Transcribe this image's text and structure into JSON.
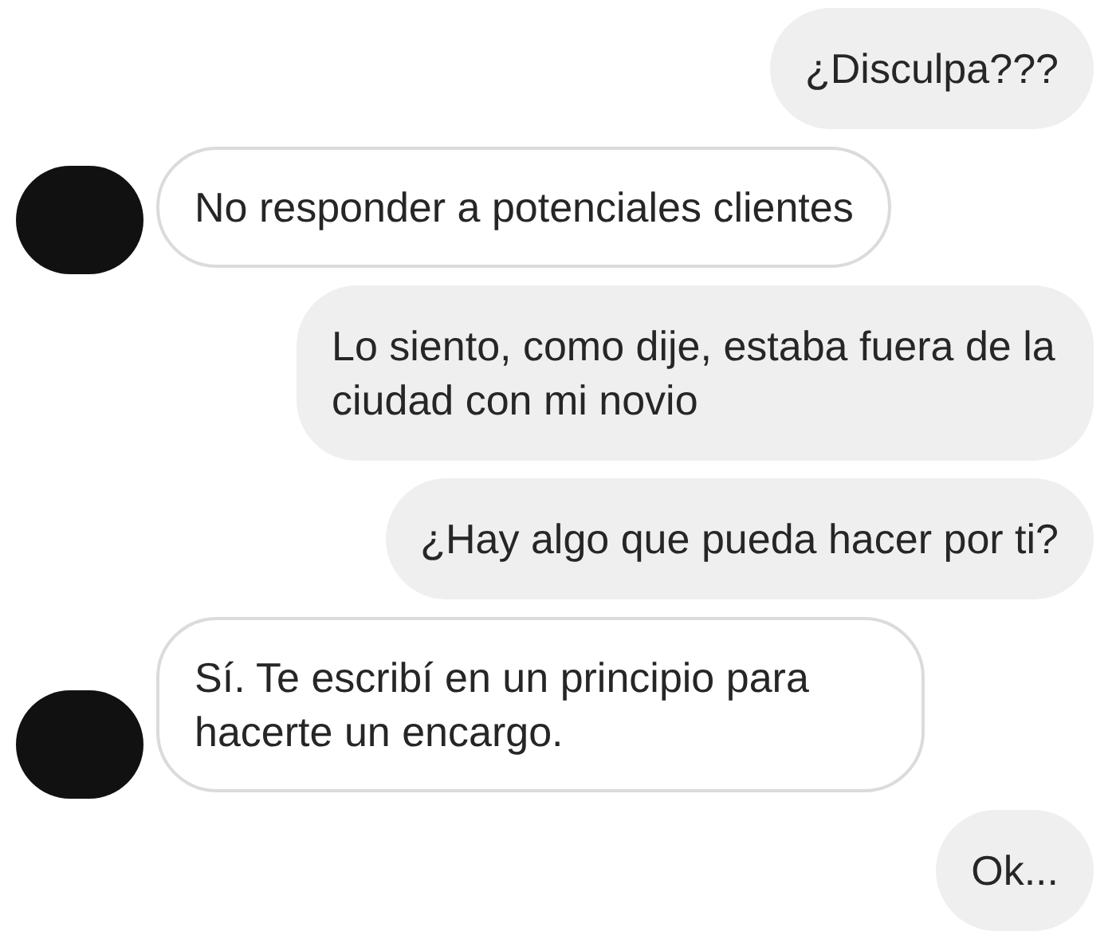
{
  "messages": [
    {
      "kind": "sent",
      "text": "¿Disculpa???"
    },
    {
      "kind": "received",
      "text": "No responder a potenciales clientes"
    },
    {
      "kind": "sent",
      "text": "Lo siento, como dije, estaba fuera de la ciudad con mi novio"
    },
    {
      "kind": "sent",
      "text": "¿Hay algo que pueda hacer por ti?"
    },
    {
      "kind": "received",
      "text": "Sí. Te escribí en un principio para hacerte un encargo."
    },
    {
      "kind": "sent",
      "text": "Ok..."
    }
  ]
}
